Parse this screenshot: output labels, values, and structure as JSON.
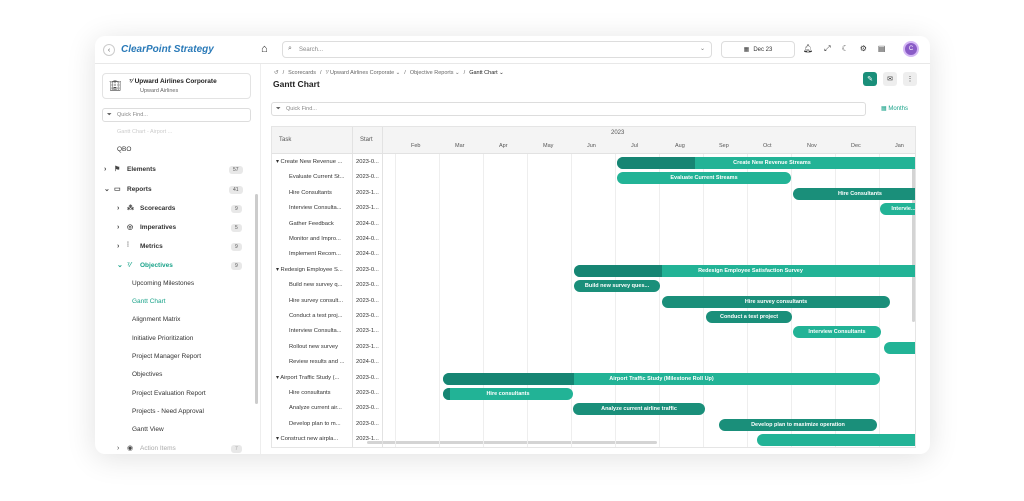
{
  "app": {
    "logo": "ClearPoint Strategy",
    "search_placeholder": "Search...",
    "date": "Dec 23",
    "avatar_initial": "C"
  },
  "sidebar": {
    "org_name": "Upward Airlines Corporate",
    "org_sub": "Upward Airlines",
    "quick_find": "Quick Find...",
    "faded_top": "Gantt Chart - Airport ...",
    "items": [
      {
        "label": "QBO"
      },
      {
        "label": "Elements",
        "count": "57"
      },
      {
        "label": "Reports",
        "count": "41"
      },
      {
        "label": "Scorecards",
        "count": "9"
      },
      {
        "label": "Imperatives",
        "count": "5"
      },
      {
        "label": "Metrics",
        "count": "9"
      },
      {
        "label": "Objectives",
        "count": "9"
      },
      {
        "label": "Upcoming Milestones"
      },
      {
        "label": "Gantt Chart"
      },
      {
        "label": "Alignment Matrix"
      },
      {
        "label": "Initiative Prioritization"
      },
      {
        "label": "Project Manager Report"
      },
      {
        "label": "Objectives"
      },
      {
        "label": "Project Evaluation Report"
      },
      {
        "label": "Projects - Need Approval"
      },
      {
        "label": "Gantt View"
      },
      {
        "label": "Action Items",
        "count": "7"
      }
    ]
  },
  "breadcrumb": [
    "Scorecards",
    "Upward Airlines Corporate",
    "Objective Reports",
    "Gantt Chart"
  ],
  "page_title": "Gantt Chart",
  "quick_find": "Quick Find...",
  "view_mode": "Months",
  "gantt": {
    "task_header": "Task",
    "start_header": "Start",
    "year": "2023",
    "months": [
      "Feb",
      "Mar",
      "Apr",
      "May",
      "Jun",
      "Jul",
      "Aug",
      "Sep",
      "Oct",
      "Nov",
      "Dec",
      "Jan"
    ],
    "rows": [
      {
        "task": "Create New Revenue ...",
        "start": "2023-0...",
        "group": true
      },
      {
        "task": "Evaluate Current St...",
        "start": "2023-0..."
      },
      {
        "task": "Hire Consultants",
        "start": "2023-1..."
      },
      {
        "task": "Interview Consulta...",
        "start": "2023-1..."
      },
      {
        "task": "Gather Feedback",
        "start": "2024-0..."
      },
      {
        "task": "Monitor and Impro...",
        "start": "2024-0..."
      },
      {
        "task": "Implement Recom...",
        "start": "2024-0..."
      },
      {
        "task": "Redesign Employee S...",
        "start": "2023-0...",
        "group": true
      },
      {
        "task": "Build new survey q...",
        "start": "2023-0..."
      },
      {
        "task": "Hire survey consult...",
        "start": "2023-0..."
      },
      {
        "task": "Conduct a test proj...",
        "start": "2023-0..."
      },
      {
        "task": "Interview Consulta...",
        "start": "2023-1..."
      },
      {
        "task": "Rollout new survey",
        "start": "2023-1..."
      },
      {
        "task": "Review results and ...",
        "start": "2024-0..."
      },
      {
        "task": "Airport Traffic Study (...",
        "start": "2023-0...",
        "group": true
      },
      {
        "task": "Hire consultants",
        "start": "2023-0..."
      },
      {
        "task": "Analyze current air...",
        "start": "2023-0..."
      },
      {
        "task": "Develop plan to m...",
        "start": "2023-0..."
      },
      {
        "task": "Construct new airpla...",
        "start": "2023-1...",
        "group": true
      }
    ],
    "bars": [
      {
        "label": "Create New Revenue Streams"
      },
      {
        "label": "Evaluate Current Streams"
      },
      {
        "label": "Hire Consultants"
      },
      {
        "label": "Intervie..."
      },
      {
        "label": "Redesign Employee Satisfaction Survey"
      },
      {
        "label": "Build new survey ques..."
      },
      {
        "label": "Hire survey consultants"
      },
      {
        "label": "Conduct a test project"
      },
      {
        "label": "Interview Consultants"
      },
      {
        "label": "Airport Traffic Study (Milestone Roll Up)"
      },
      {
        "label": "Hire consultants"
      },
      {
        "label": "Analyze current airline traffic"
      },
      {
        "label": "Develop plan to maximize operation"
      }
    ]
  }
}
